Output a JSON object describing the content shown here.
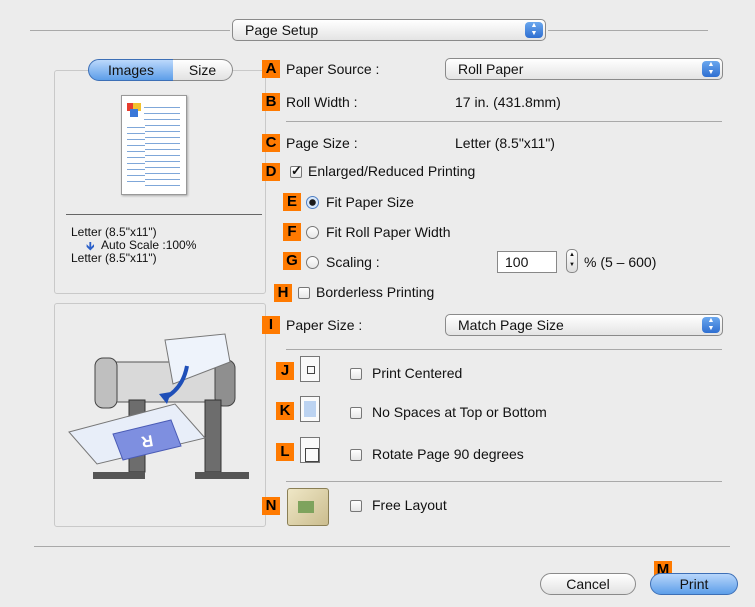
{
  "page_setup_popup": {
    "label": "Page Setup"
  },
  "tabs": [
    {
      "label": "Images"
    },
    {
      "label": "Size"
    }
  ],
  "preview": {
    "line1": "Letter (8.5\"x11\")",
    "line2": "Auto Scale :100%",
    "line3": "Letter (8.5\"x11\")"
  },
  "badges": {
    "A": "A",
    "B": "B",
    "C": "C",
    "D": "D",
    "E": "E",
    "F": "F",
    "G": "G",
    "H": "H",
    "I": "I",
    "J": "J",
    "K": "K",
    "L": "L",
    "M": "M",
    "N": "N"
  },
  "paper_source": {
    "label": "Paper Source :",
    "value": "Roll Paper"
  },
  "roll_width": {
    "label": "Roll Width :",
    "value": "17 in. (431.8mm)"
  },
  "page_size": {
    "label": "Page Size :",
    "value": "Letter (8.5\"x11\")"
  },
  "enlarged_reduced": {
    "label": "Enlarged/Reduced Printing",
    "checked": true
  },
  "fit_paper_size": {
    "label": "Fit Paper Size",
    "selected": true
  },
  "fit_roll_width": {
    "label": "Fit Roll Paper Width",
    "selected": false
  },
  "scaling": {
    "label": "Scaling :",
    "value": "100",
    "range": "% (5 – 600)",
    "selected": false
  },
  "borderless": {
    "label": "Borderless Printing",
    "checked": false
  },
  "paper_size": {
    "label": "Paper Size :",
    "value": "Match Page Size"
  },
  "print_centered": {
    "label": "Print Centered",
    "checked": false
  },
  "no_spaces": {
    "label": "No Spaces at Top or Bottom",
    "checked": false
  },
  "rotate": {
    "label": "Rotate Page 90 degrees",
    "checked": false
  },
  "free_layout": {
    "label": "Free Layout",
    "checked": false
  },
  "buttons": {
    "cancel": "Cancel",
    "print": "Print"
  }
}
